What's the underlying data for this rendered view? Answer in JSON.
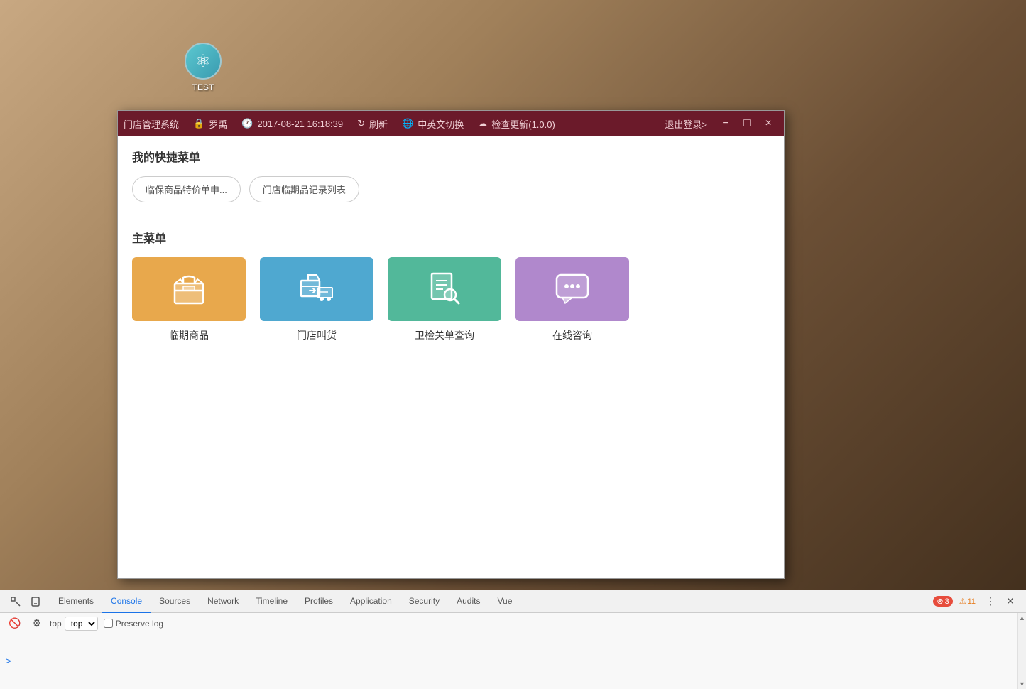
{
  "desktop": {
    "icon_label": "TEST",
    "icon_symbol": "⚛"
  },
  "titlebar": {
    "app_name": "门店管理系统",
    "user_icon": "🔒",
    "username": "罗禹",
    "clock_icon": "🕐",
    "datetime": "2017-08-21 16:18:39",
    "refresh_icon": "↻",
    "refresh_label": "刷新",
    "lang_icon": "🌐",
    "lang_label": "中英文切换",
    "update_icon": "☁",
    "update_label": "检查更新(1.0.0)",
    "logout_label": "退出登录>",
    "minimize_label": "−",
    "maximize_label": "□",
    "close_label": "×"
  },
  "app": {
    "quick_menu_title": "我的快捷菜单",
    "quick_items": [
      {
        "label": "临保商品特价单申..."
      },
      {
        "label": "门店临期品记录列表"
      }
    ],
    "main_menu_title": "主菜单",
    "menu_cards": [
      {
        "label": "临期商品",
        "color": "orange",
        "icon": "📦"
      },
      {
        "label": "门店叫货",
        "color": "blue",
        "icon": "🚚"
      },
      {
        "label": "卫检关单查询",
        "color": "green",
        "icon": "🔍"
      },
      {
        "label": "在线咨询",
        "color": "purple",
        "icon": "💬"
      }
    ]
  },
  "devtools": {
    "tabs": [
      {
        "label": "Elements",
        "active": false
      },
      {
        "label": "Console",
        "active": true
      },
      {
        "label": "Sources",
        "active": false
      },
      {
        "label": "Network",
        "active": false
      },
      {
        "label": "Timeline",
        "active": false
      },
      {
        "label": "Profiles",
        "active": false
      },
      {
        "label": "Application",
        "active": false
      },
      {
        "label": "Security",
        "active": false
      },
      {
        "label": "Audits",
        "active": false
      },
      {
        "label": "Vue",
        "active": false
      }
    ],
    "error_count": "3",
    "warn_count": "11",
    "filter_value": "top",
    "preserve_log_label": "Preserve log",
    "console_prompt": ">"
  }
}
